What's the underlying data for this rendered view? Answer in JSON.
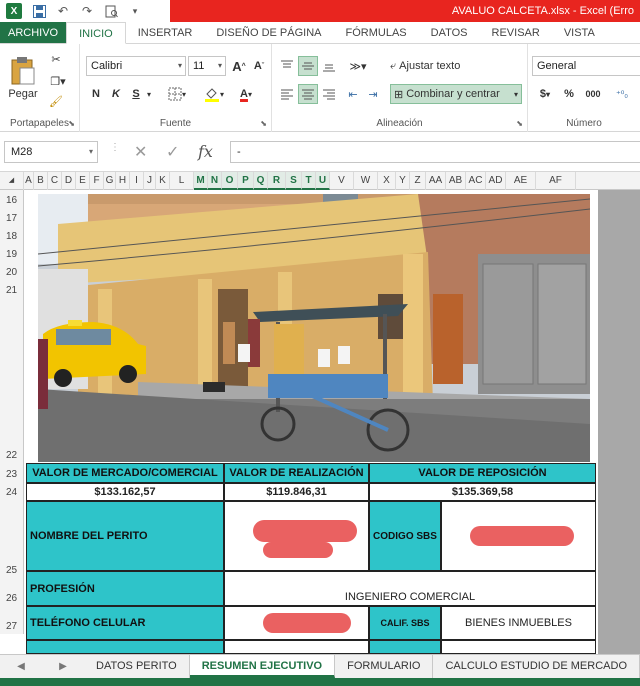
{
  "window": {
    "title": "AVALUO CALCETA.xlsx - Excel (Erro"
  },
  "ribbon_tabs": [
    "ARCHIVO",
    "INICIO",
    "INSERTAR",
    "DISEÑO DE PÁGINA",
    "FÓRMULAS",
    "DATOS",
    "REVISAR",
    "VISTA"
  ],
  "ribbon": {
    "paste_label": "Pegar",
    "clipboard_label": "Portapapeles",
    "font_name": "Calibri",
    "font_size": "11",
    "font_group_label": "Fuente",
    "bold": "N",
    "italic": "K",
    "underline": "S",
    "wrap_text": "Ajustar texto",
    "merge_center": "Combinar y centrar",
    "alignment_label": "Alineación",
    "number_format": "General",
    "number_label": "Número",
    "percent": "%",
    "thousands": "000",
    "currency": "$"
  },
  "formula_bar": {
    "name_box": "M28",
    "formula": "-"
  },
  "columns": [
    "A",
    "B",
    "C",
    "D",
    "E",
    "F",
    "G",
    "H",
    "I",
    "J",
    "K",
    "L",
    "M",
    "N",
    "O",
    "P",
    "Q",
    "R",
    "S",
    "T",
    "U",
    "V",
    "W",
    "X",
    "Y",
    "Z",
    "AA",
    "AB",
    "AC",
    "AD",
    "AE",
    "AF"
  ],
  "selected_columns": [
    "M",
    "N",
    "O",
    "P",
    "Q",
    "R",
    "S",
    "T",
    "U"
  ],
  "rows": [
    "16",
    "17",
    "18",
    "19",
    "20",
    "21",
    "22",
    "23",
    "24",
    "25",
    "26",
    "27"
  ],
  "summary": {
    "market_label": "VALOR DE MERCADO/COMERCIAL",
    "realization_label": "VALOR DE REALIZACIÓN",
    "replacement_label": "VALOR DE REPOSICIÓN",
    "market_value": "$133.162,57",
    "realization_value": "$119.846,31",
    "replacement_value": "$135.369,58",
    "expert_label": "NOMBRE DEL PERITO",
    "sbs_code_label": "CODIGO SBS",
    "profession_label": "PROFESIÓN",
    "profession_value": "INGENIERO COMERCIAL",
    "phone_label": "TELÉFONO CELULAR",
    "calif_label": "CALIF. SBS",
    "calif_value": "BIENES INMUEBLES"
  },
  "sheet_tabs": [
    "DATOS PERITO",
    "RESUMEN EJECUTIVO",
    "FORMULARIO",
    "CALCULO ESTUDIO DE MERCADO"
  ],
  "colors": {
    "excel_green": "#217346",
    "title_red": "#e8251f",
    "teal_cells": "#2ec4c9"
  }
}
